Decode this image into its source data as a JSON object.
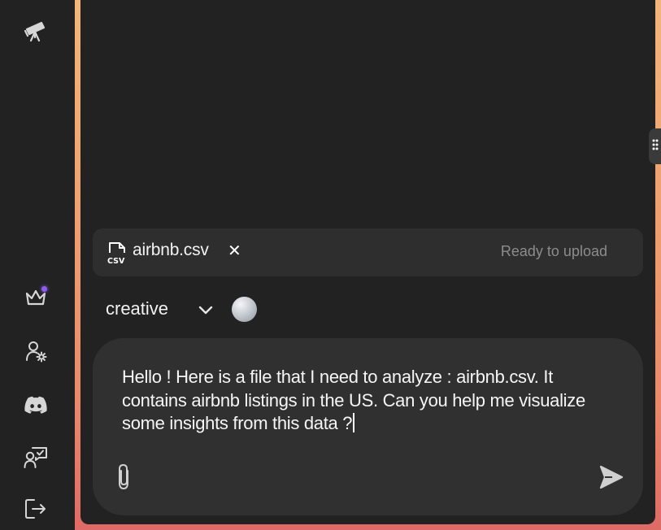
{
  "sidebar": {
    "items": [
      {
        "icon": "telescope-icon"
      },
      {
        "icon": "crown-icon",
        "badge_color": "#8e5bf0"
      },
      {
        "icon": "user-settings-icon"
      },
      {
        "icon": "discord-icon"
      },
      {
        "icon": "feedback-icon"
      },
      {
        "icon": "logout-icon"
      }
    ]
  },
  "attachment": {
    "file_name": "airbnb.csv",
    "file_icon": "csv-file-icon",
    "remove_label": "✕",
    "status": "Ready to upload"
  },
  "mode": {
    "selected": "creative"
  },
  "composer": {
    "text": "Hello ! Here is a file that I need to analyze : airbnb.csv. It contains airbnb listings in the US. Can you help me visualize some insights from this data ?"
  },
  "colors": {
    "background": "#222222",
    "panel": "#2e2e2e",
    "composer": "#303030",
    "accent_gradient_top": "#f2b67a",
    "accent_gradient_bottom": "#e06a66"
  }
}
